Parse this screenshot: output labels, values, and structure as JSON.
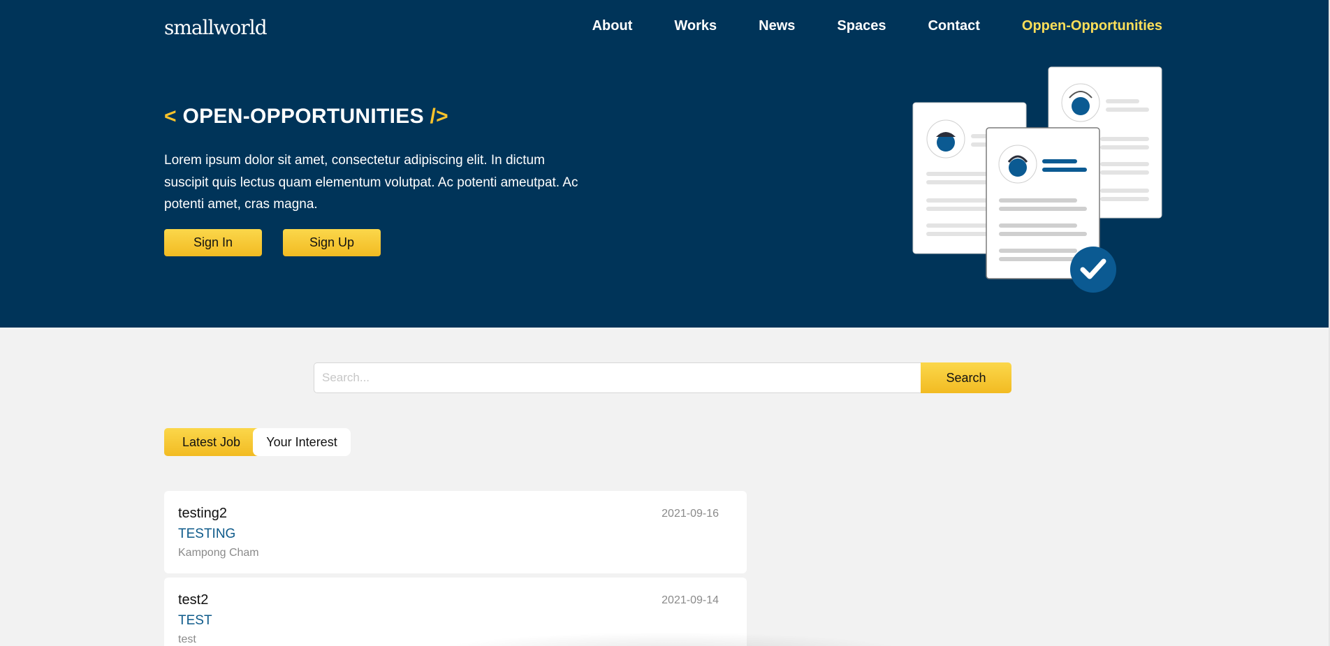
{
  "brand": {
    "logo_text": "smallworld",
    "colors": {
      "navy": "#003459",
      "yellow": "#f9c32b",
      "active_nav": "#fedf59"
    }
  },
  "nav": {
    "items": [
      "About",
      "Works",
      "News",
      "Spaces",
      "Contact",
      "Oppen-Opportunities"
    ],
    "active": "Oppen-Opportunities"
  },
  "hero": {
    "bracket_open": "<",
    "title": "OPEN-OPPORTUNITIES",
    "bracket_close": "/>",
    "description": "Lorem ipsum dolor sit amet, consectetur adipiscing elit. In dictum suscipit quis lectus quam elementum volutpat. Ac potenti ameutpat. Ac potenti amet, cras magna.",
    "sign_in": "Sign In",
    "sign_up": "Sign Up"
  },
  "search": {
    "placeholder": "Search...",
    "value": "",
    "button": "Search"
  },
  "tabs": {
    "latest": "Latest Job",
    "interest": "Your Interest",
    "active": "Latest Job"
  },
  "jobs": [
    {
      "title": "testing2",
      "date": "2021-09-16",
      "company": "TESTING",
      "location": "Kampong Cham"
    },
    {
      "title": "test2",
      "date": "2021-09-14",
      "company": "TEST",
      "location": "test"
    }
  ]
}
